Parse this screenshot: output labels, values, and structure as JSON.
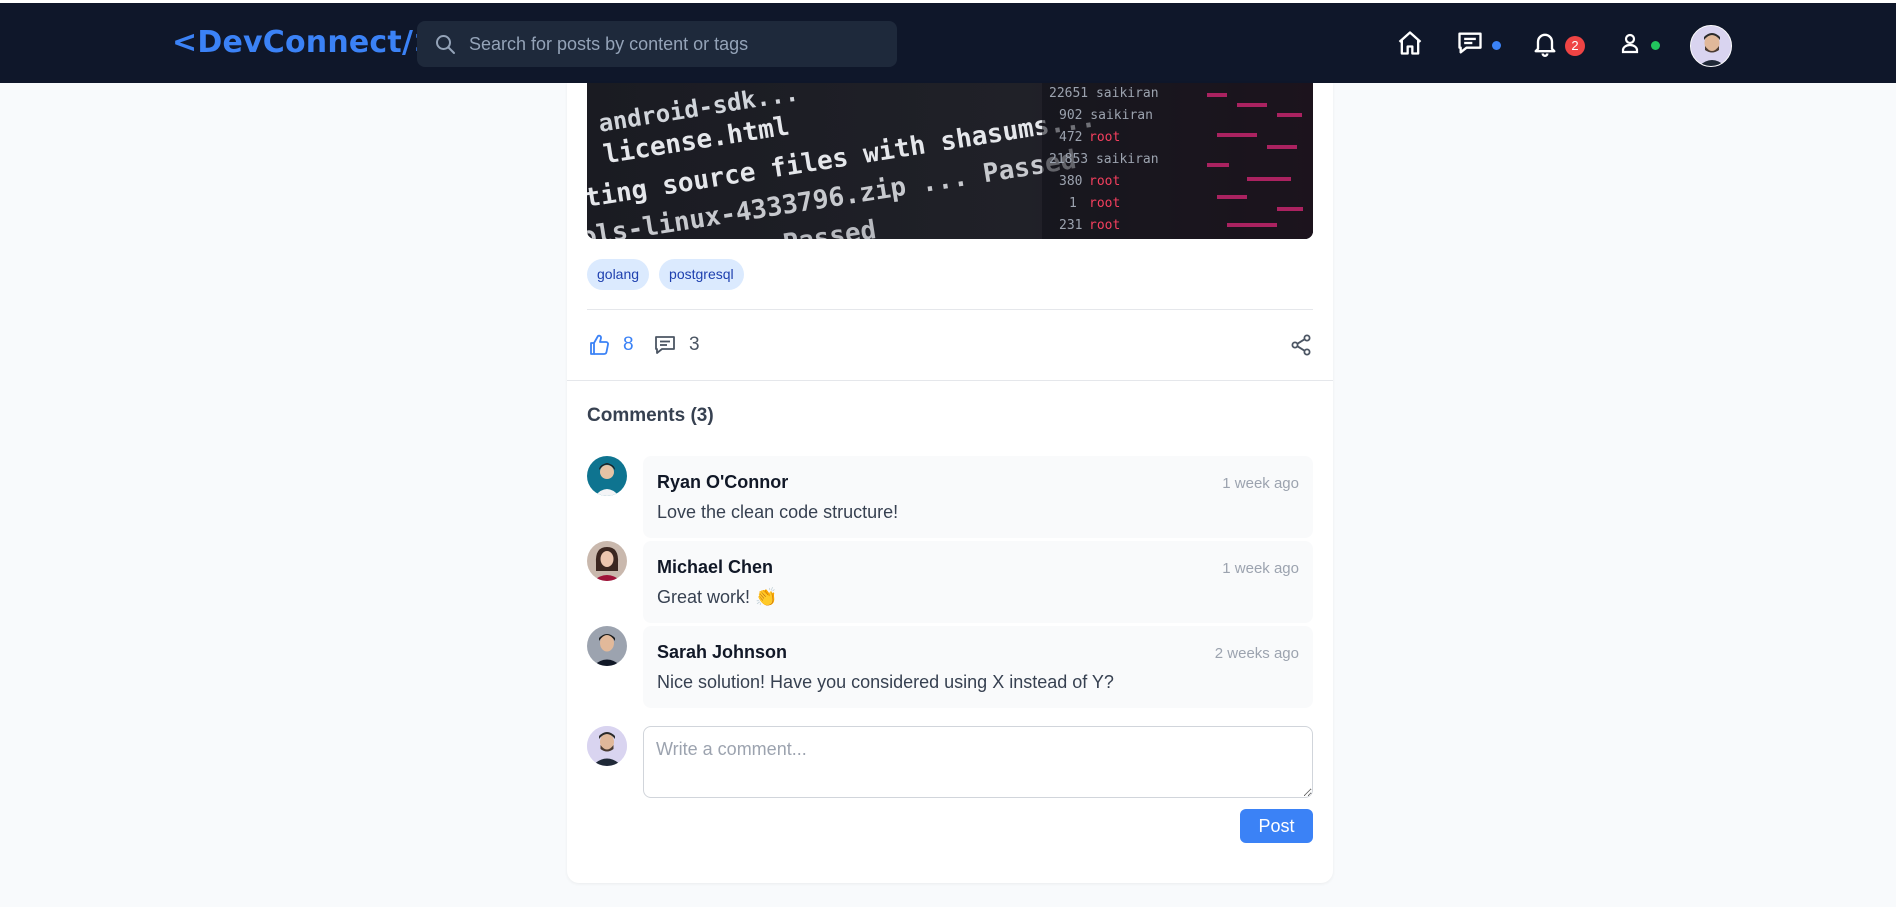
{
  "colors": {
    "header_bg": "#0f172a",
    "accent": "#3b82f6",
    "badge": "#ef4444",
    "online": "#22c55e"
  },
  "header": {
    "logo": "<DevConnect/>",
    "search_placeholder": "Search for posts by content or tags",
    "icons": [
      "home-icon",
      "messages-icon",
      "bell-icon",
      "user-icon"
    ],
    "notification_count": "2"
  },
  "post": {
    "tags": [
      "golang",
      "postgresql"
    ],
    "likes": "8",
    "comments_count": "3"
  },
  "comments": {
    "title": "Comments (3)",
    "items": [
      {
        "author": "Ryan O'Connor",
        "time": "1 week ago",
        "text": "Love the clean code structure!"
      },
      {
        "author": "Michael Chen",
        "time": "1 week ago",
        "text": "Great work! 👏"
      },
      {
        "author": "Sarah Johnson",
        "time": "2 weeks ago",
        "text": "Nice solution! Have you considered using X instead of Y?"
      }
    ],
    "input_placeholder": "Write a comment...",
    "post_button": "Post"
  }
}
